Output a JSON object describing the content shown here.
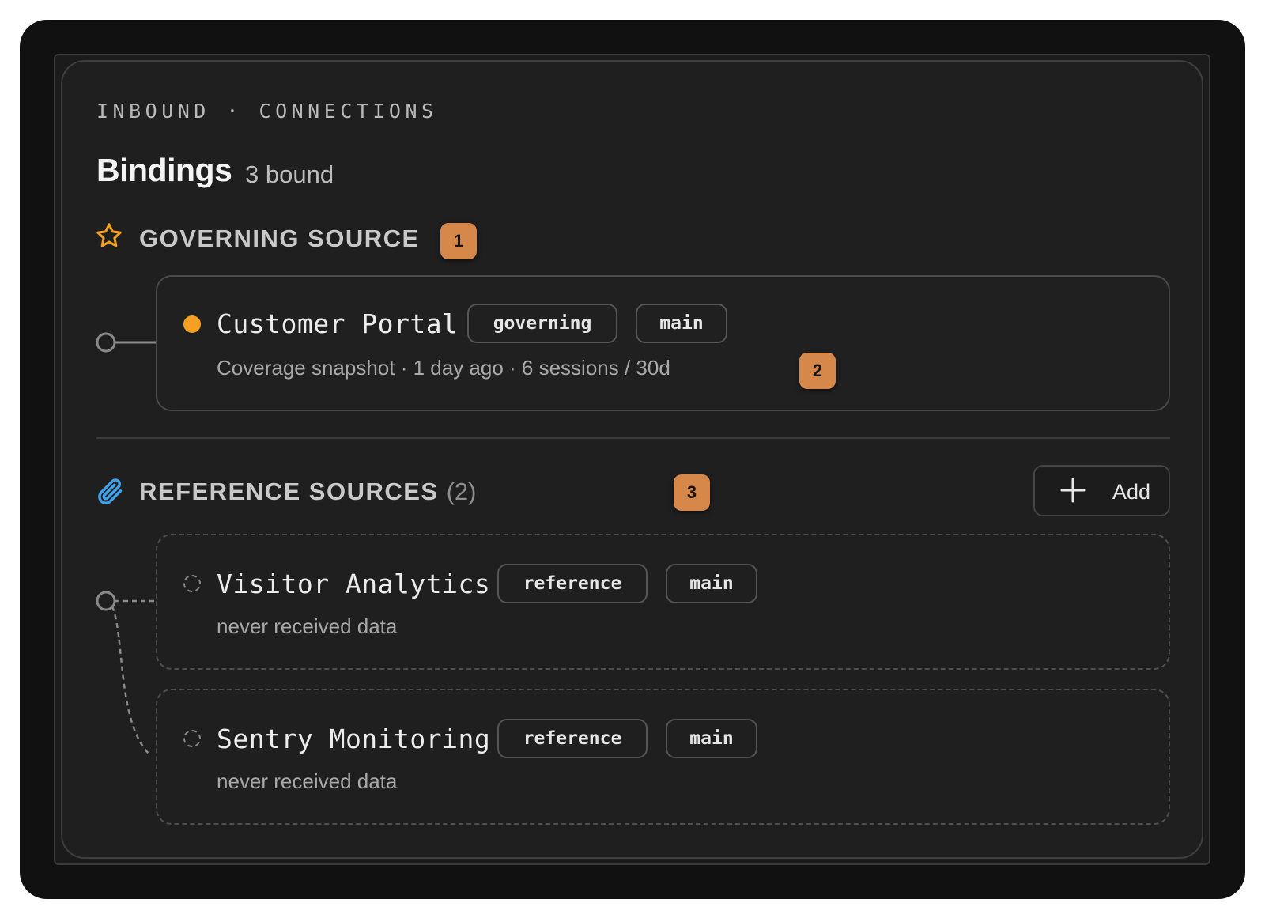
{
  "header": {
    "eyebrow": "INBOUND · CONNECTIONS",
    "title": "Bindings",
    "count": "3 bound"
  },
  "governing": {
    "heading": "GOVERNING SOURCE",
    "badge": "1",
    "source": {
      "name": "Customer Portal",
      "role": "governing",
      "branch": "main",
      "meta": "Coverage snapshot · 1 day ago · 6 sessions / 30d",
      "badge": "2",
      "status": "active"
    }
  },
  "reference": {
    "heading": "REFERENCE SOURCES",
    "count": "(2)",
    "badge": "3",
    "add_label": "Add",
    "sources": [
      {
        "name": "Visitor Analytics",
        "role": "reference",
        "branch": "main",
        "meta": "never received data",
        "status": "idle"
      },
      {
        "name": "Sentry Monitoring",
        "role": "reference",
        "branch": "main",
        "meta": "never received data",
        "status": "idle"
      }
    ]
  },
  "colors": {
    "accent_orange": "#f5a020",
    "badge": "#d6884a",
    "paperclip": "#3fa2ea",
    "star": "#f5a020"
  },
  "icons": [
    "star-icon",
    "paperclip-icon",
    "plus-icon",
    "status-dot-icon"
  ]
}
